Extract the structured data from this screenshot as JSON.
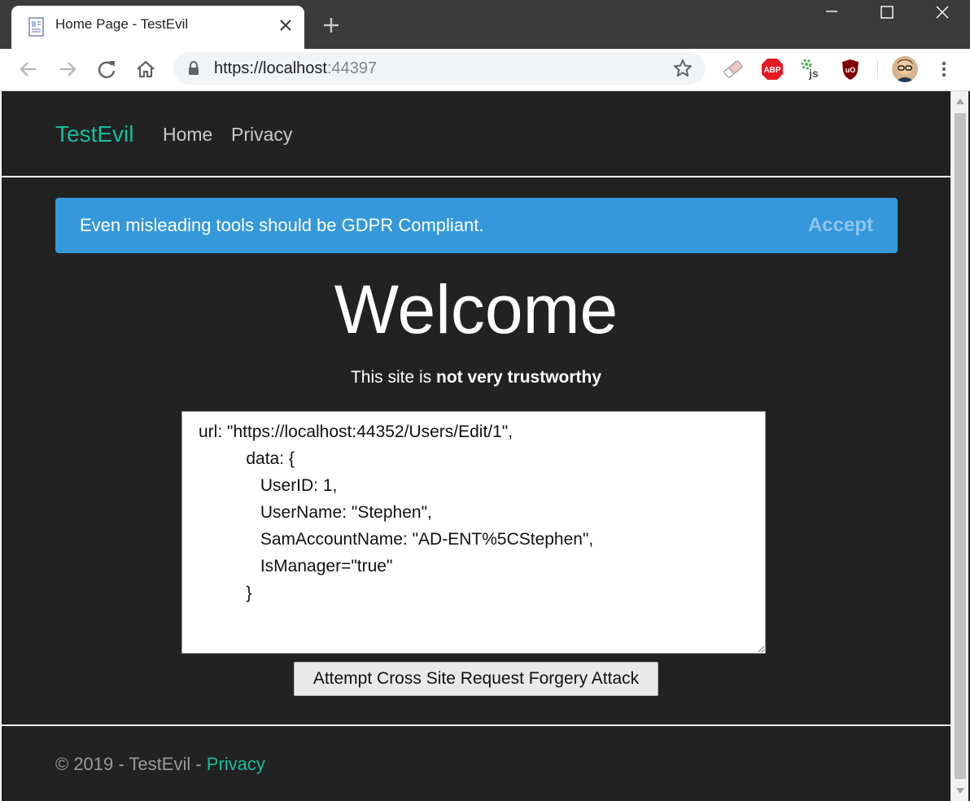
{
  "browser": {
    "tab_title": "Home Page - TestEvil",
    "url_host": "https://localhost",
    "url_port": ":44397"
  },
  "site": {
    "brand": "TestEvil",
    "nav": {
      "home": "Home",
      "privacy": "Privacy"
    }
  },
  "gdpr": {
    "message": "Even misleading tools should be GDPR Compliant.",
    "accept_label": "Accept"
  },
  "hero": {
    "title": "Welcome",
    "subtitle_prefix": "This site is ",
    "subtitle_emphasis": "not very trustworthy"
  },
  "payload": {
    "value": "url: \"https://localhost:44352/Users/Edit/1\",\n          data: {\n             UserID: 1,\n             UserName: \"Stephen\",\n             SamAccountName: \"AD-ENT%5CStephen\",\n             IsManager=\"true\"\n          }"
  },
  "attack_button": {
    "label": "Attempt Cross Site Request Forgery Attack"
  },
  "footer": {
    "text": "© 2019 - TestEvil - ",
    "privacy_link": "Privacy"
  },
  "colors": {
    "page_bg": "#222222",
    "brand": "#18bc9c",
    "alert_bg": "#3498db",
    "accept_text": "#8ec5ed"
  }
}
